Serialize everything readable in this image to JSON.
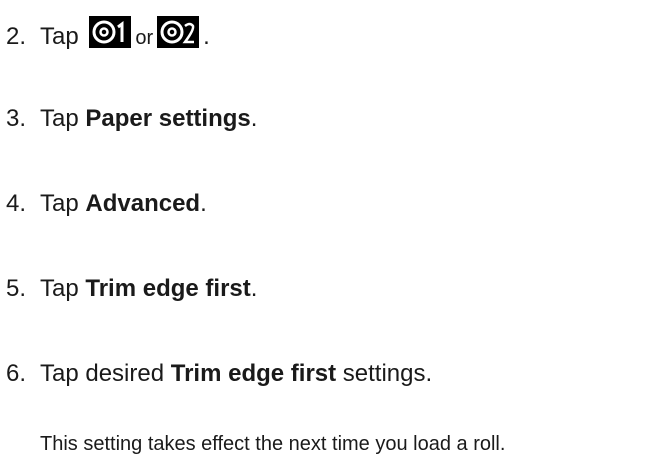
{
  "steps": [
    {
      "number": "2.",
      "pre": "Tap ",
      "mid": "or",
      "post": ".",
      "icon1": "roll-1-icon",
      "icon2": "roll-2-icon"
    },
    {
      "number": "3.",
      "pre": "Tap ",
      "bold": "Paper settings",
      "post": "."
    },
    {
      "number": "4.",
      "pre": "Tap ",
      "bold": "Advanced",
      "post": "."
    },
    {
      "number": "5.",
      "pre": "Tap ",
      "bold": "Trim edge first",
      "post": "."
    },
    {
      "number": "6.",
      "pre": "Tap desired ",
      "bold": "Trim edge first",
      "post": " settings."
    }
  ],
  "note": "This setting takes effect the next time you load a roll.",
  "icon_bg": "#000000",
  "icon_fg": "#ffffff"
}
